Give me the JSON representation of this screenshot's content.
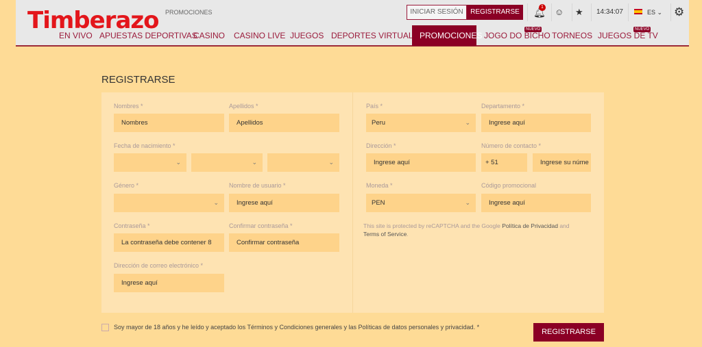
{
  "header": {
    "logo": "Timberazo",
    "breadcrumb": "PROMOCIONES",
    "login": "INICIAR SESIÓN",
    "register": "REGISTRARSE",
    "notification_count": "1",
    "time": "14:34:07",
    "language": "ES",
    "nav": [
      {
        "label": "EN VIVO"
      },
      {
        "label": "APUESTAS DEPORTIVAS"
      },
      {
        "label": "CASINO"
      },
      {
        "label": "CASINO LIVE"
      },
      {
        "label": "JUEGOS"
      },
      {
        "label": "DEPORTES VIRTUALES"
      },
      {
        "label": "PROMOCIONES",
        "active": true
      },
      {
        "label": "JOGO DO BICHO",
        "badge": "NUEVO"
      },
      {
        "label": "TORNEOS"
      },
      {
        "label": "JUEGOS DE TV",
        "badge": "NUEVO"
      }
    ]
  },
  "form": {
    "title": "REGISTRARSE",
    "nombres": {
      "label": "Nombres *",
      "value": "Nombres"
    },
    "apellidos": {
      "label": "Apellidos *",
      "value": "Apellidos"
    },
    "fecha": {
      "label": "Fecha de nacimiento *"
    },
    "genero": {
      "label": "Género *"
    },
    "usuario": {
      "label": "Nombre de usuario *",
      "value": "Ingrese aquí"
    },
    "contrasena": {
      "label": "Contraseña *",
      "value": "La contraseña debe contener 8"
    },
    "confirmar": {
      "label": "Confirmar contraseña *",
      "value": "Confirmar contraseña"
    },
    "correo": {
      "label": "Dirección de correo electrónico *",
      "value": "Ingrese aquí"
    },
    "pais": {
      "label": "País *",
      "value": "Peru"
    },
    "departamento": {
      "label": "Departamento *",
      "value": "Ingrese aquí"
    },
    "direccion": {
      "label": "Dirección *",
      "value": "Ingrese aquí"
    },
    "contacto": {
      "label": "Número de contacto *",
      "prefix": "+ 51",
      "value": "Ingrese su núme"
    },
    "moneda": {
      "label": "Moneda *",
      "value": "PEN"
    },
    "promo": {
      "label": "Código promocional",
      "value": "Ingrese aquí"
    },
    "legal": {
      "text1": "This site is protected by reCAPTCHA and the Google ",
      "privacy": "Política de Privacidad",
      "text2": " and ",
      "terms": "Terms of Service",
      "text3": "."
    },
    "accept": "Soy mayor de 18 años y he leído y aceptado los Términos y Condiciones generales y las Políticas de datos personales y privacidad. *",
    "submit": "REGISTRARSE"
  },
  "colors": {
    "brand": "#8b0025",
    "logo": "#e3161b",
    "page_bg": "#fedb96",
    "input_bg": "#fed38a"
  }
}
